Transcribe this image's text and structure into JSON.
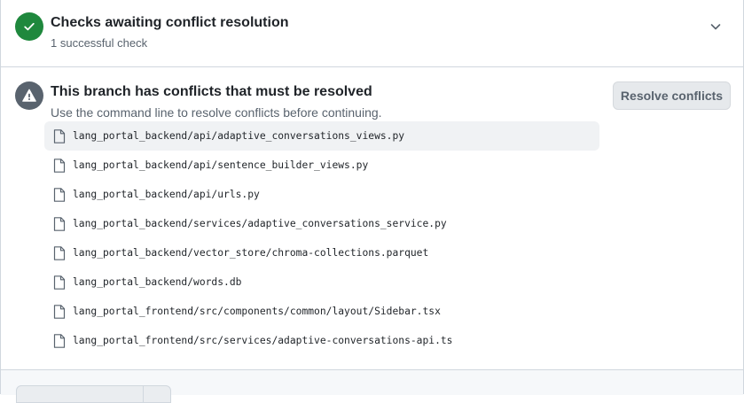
{
  "checks": {
    "title": "Checks awaiting conflict resolution",
    "subtitle": "1 successful check",
    "status_icon": "check-icon",
    "status_color": "#1f883d"
  },
  "conflicts": {
    "title": "This branch has conflicts that must be resolved",
    "subtitle": "Use the command line to resolve conflicts before continuing.",
    "alert_icon": "alert-icon",
    "resolve_label": "Resolve conflicts",
    "files": [
      "lang_portal_backend/api/adaptive_conversations_views.py",
      "lang_portal_backend/api/sentence_builder_views.py",
      "lang_portal_backend/api/urls.py",
      "lang_portal_backend/services/adaptive_conversations_service.py",
      "lang_portal_backend/vector_store/chroma-collections.parquet",
      "lang_portal_backend/words.db",
      "lang_portal_frontend/src/components/common/layout/Sidebar.tsx",
      "lang_portal_frontend/src/services/adaptive-conversations-api.ts"
    ]
  }
}
